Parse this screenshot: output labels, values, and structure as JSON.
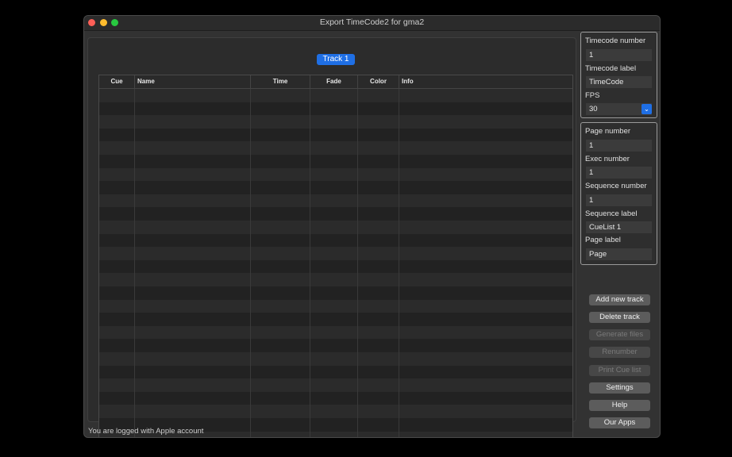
{
  "window": {
    "title": "Export TimeCode2 for gma2"
  },
  "tabs": [
    {
      "label": "Track 1",
      "active": true
    }
  ],
  "table": {
    "columns": [
      "Cue",
      "Name",
      "Time",
      "Fade",
      "Color",
      "Info"
    ],
    "rows": []
  },
  "status": "You are logged with Apple account",
  "timecode_group": {
    "timecode_number_label": "Timecode number",
    "timecode_number_value": "1",
    "timecode_label_label": "Timecode label",
    "timecode_label_value": "TimeCode",
    "fps_label": "FPS",
    "fps_value": "30"
  },
  "sequence_group": {
    "page_number_label": "Page number",
    "page_number_value": "1",
    "exec_number_label": "Exec number",
    "exec_number_value": "1",
    "sequence_number_label": "Sequence number",
    "sequence_number_value": "1",
    "sequence_label_label": "Sequence label",
    "sequence_label_value": "CueList 1",
    "page_label_label": "Page label",
    "page_label_value": "Page"
  },
  "buttons": {
    "add_new_track": "Add new track",
    "delete_track": "Delete track",
    "generate_files": "Generate files",
    "renumber": "Renumber",
    "print_cue_list": "Print Cue list",
    "settings": "Settings",
    "help": "Help",
    "our_apps": "Our Apps"
  },
  "colors": {
    "accent": "#1f6fe5",
    "close": "#fe5f57",
    "minimize": "#febc2e",
    "maximize": "#28c840"
  }
}
